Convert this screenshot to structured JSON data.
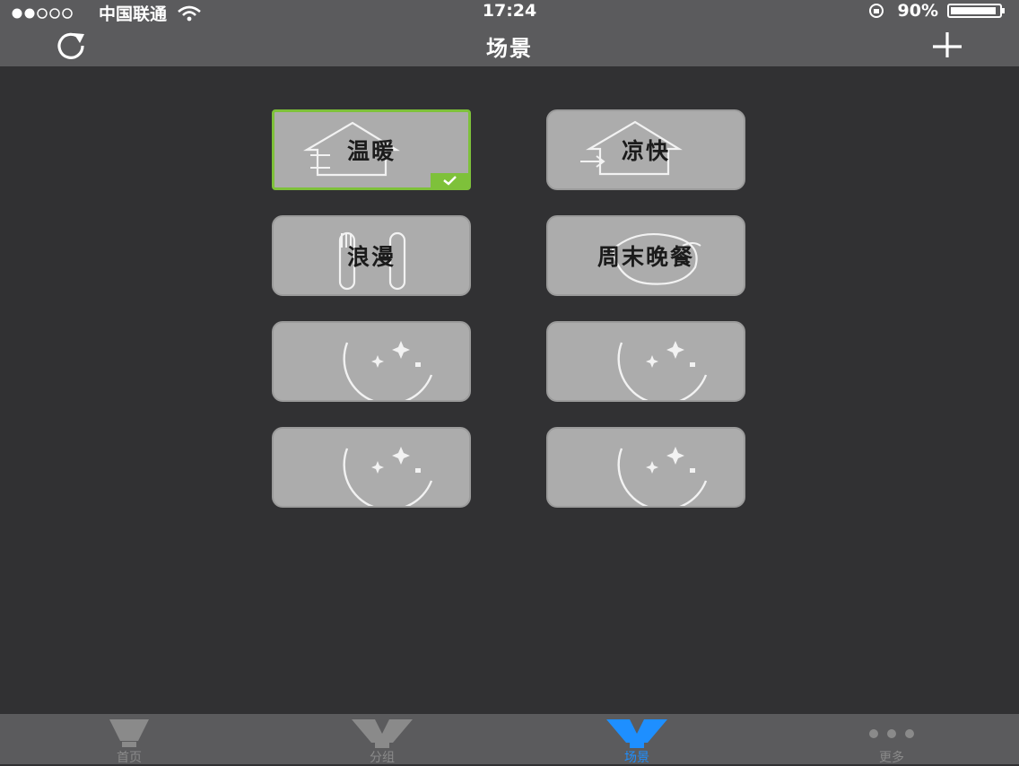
{
  "status_bar": {
    "carrier": "中国联通",
    "time": "17:24",
    "battery": "90%"
  },
  "nav": {
    "title": "场景"
  },
  "scenes": [
    {
      "label": "温暖",
      "icon": "house-icon",
      "selected": true
    },
    {
      "label": "凉快",
      "icon": "house-icon",
      "selected": false
    },
    {
      "label": "浪漫",
      "icon": "fork-knife-icon",
      "selected": false
    },
    {
      "label": "周末晚餐",
      "icon": "steak-icon",
      "selected": false
    },
    {
      "label": "",
      "icon": "moon-stars-icon",
      "selected": false
    },
    {
      "label": "",
      "icon": "moon-stars-icon",
      "selected": false
    },
    {
      "label": "",
      "icon": "moon-stars-icon",
      "selected": false
    },
    {
      "label": "",
      "icon": "moon-stars-icon",
      "selected": false
    }
  ],
  "tabs": [
    {
      "label": "首页",
      "icon": "bulb-icon",
      "active": false
    },
    {
      "label": "分组",
      "icon": "group-icon",
      "active": false
    },
    {
      "label": "场景",
      "icon": "scene-icon",
      "active": true
    },
    {
      "label": "更多",
      "icon": "more-icon",
      "active": false
    }
  ],
  "colors": {
    "background": "#313133",
    "bar": "#5b5b5d",
    "tile": "#acacac",
    "selected": "#7ec13a",
    "active_tab": "#1e8fff"
  }
}
